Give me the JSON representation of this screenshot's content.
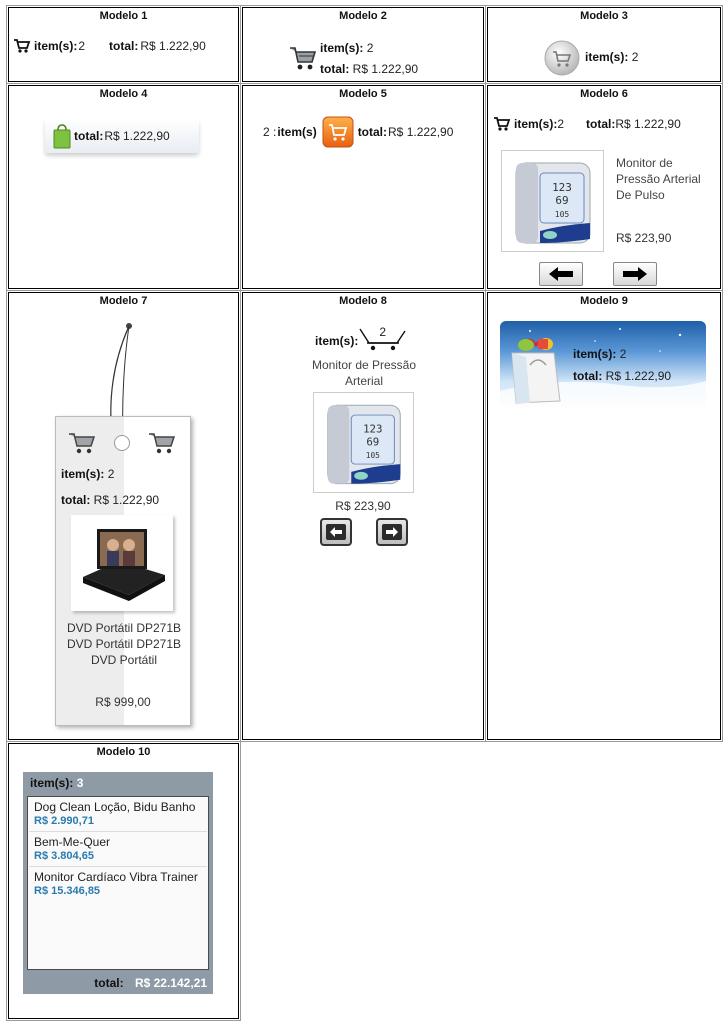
{
  "models": [
    {
      "title": "Modelo 1"
    },
    {
      "title": "Modelo 2"
    },
    {
      "title": "Modelo 3"
    },
    {
      "title": "Modelo 4"
    },
    {
      "title": "Modelo 5"
    },
    {
      "title": "Modelo 6"
    },
    {
      "title": "Modelo 7"
    },
    {
      "title": "Modelo 8"
    },
    {
      "title": "Modelo 9"
    },
    {
      "title": "Modelo 10"
    }
  ],
  "cart": {
    "items_label": "item(s):",
    "items_label_m5": "item(s)",
    "items_count": "2",
    "items_count_m5": "2 :",
    "total_label": "total:",
    "total_value": "R$ 1.222,90"
  },
  "product_monitor": {
    "name": "Monitor de Pressão Arterial De Pulso",
    "name_short": "Monitor de Pressão Arterial",
    "price": "R$ 223,90",
    "screen_lines": [
      "123",
      "69",
      "105"
    ]
  },
  "product_dvd": {
    "name": "DVD Portátil DP271B DVD Portátil DP271B DVD Portátil",
    "price": "R$ 999,00"
  },
  "m8_count": "2",
  "m10": {
    "items_label": "item(s):",
    "items_count": "3",
    "items": [
      {
        "name": "Dog Clean Loção, Bidu Banho",
        "price": "R$ 2.990,71"
      },
      {
        "name": "Bem-Me-Quer",
        "price": "R$ 3.804,65"
      },
      {
        "name": "Monitor Cardíaco Vibra Trainer",
        "price": "R$ 15.346,85"
      }
    ],
    "total_label": "total:",
    "total_value": "R$ 22.142,21"
  },
  "colors": {
    "m10_header": "#8e9aa6",
    "m10_price": "#2a7ab0",
    "m9_blue": "#1f5fa8",
    "m5_orange": "#f07a1a"
  },
  "icons": [
    "cart-icon",
    "shopping-bag-icon",
    "arrow-left-icon",
    "arrow-right-icon",
    "gift-bag-icon"
  ]
}
